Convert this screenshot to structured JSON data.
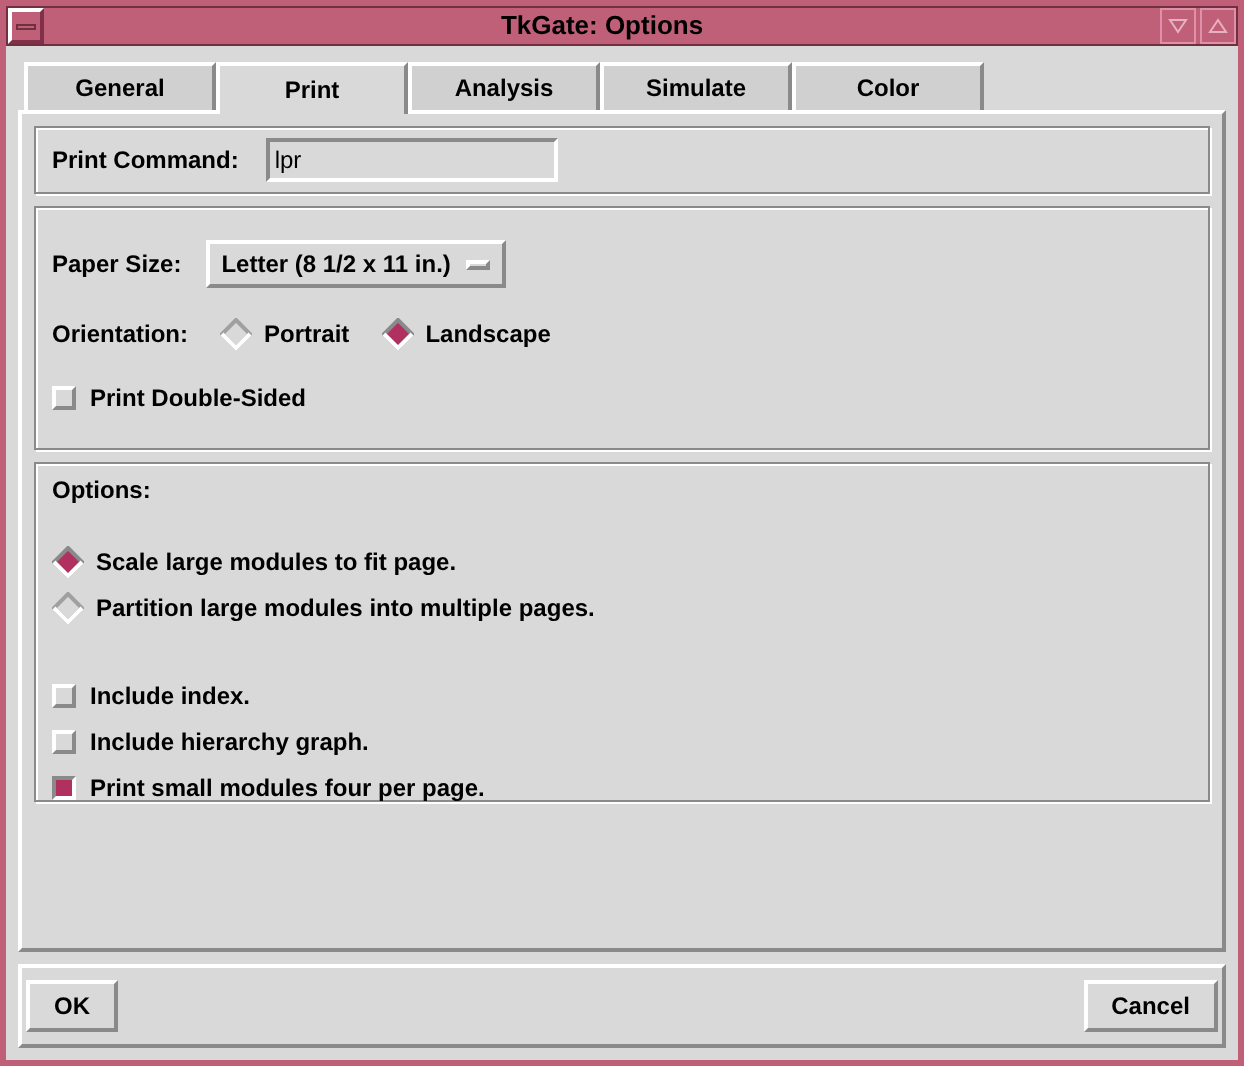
{
  "window": {
    "title": "TkGate: Options"
  },
  "tabs": [
    {
      "label": "General",
      "selected": false
    },
    {
      "label": "Print",
      "selected": true
    },
    {
      "label": "Analysis",
      "selected": false
    },
    {
      "label": "Simulate",
      "selected": false
    },
    {
      "label": "Color",
      "selected": false
    }
  ],
  "print_command": {
    "label": "Print Command:",
    "value": "lpr"
  },
  "paper_size": {
    "label": "Paper Size:",
    "value": "Letter (8 1/2 x 11 in.)"
  },
  "orientation": {
    "label": "Orientation:",
    "options": [
      {
        "label": "Portrait",
        "selected": false
      },
      {
        "label": "Landscape",
        "selected": true
      }
    ]
  },
  "double_sided": {
    "label": "Print Double-Sided",
    "checked": false
  },
  "options": {
    "heading": "Options:",
    "radios": [
      {
        "label": "Scale large modules to fit page.",
        "selected": true
      },
      {
        "label": "Partition large modules into multiple pages.",
        "selected": false
      }
    ],
    "checkboxes": [
      {
        "label": "Include index.",
        "checked": false
      },
      {
        "label": "Include hierarchy graph.",
        "checked": false
      },
      {
        "label": "Print small modules four per page.",
        "checked": true
      }
    ]
  },
  "buttons": [
    "OK",
    "Cancel"
  ]
}
